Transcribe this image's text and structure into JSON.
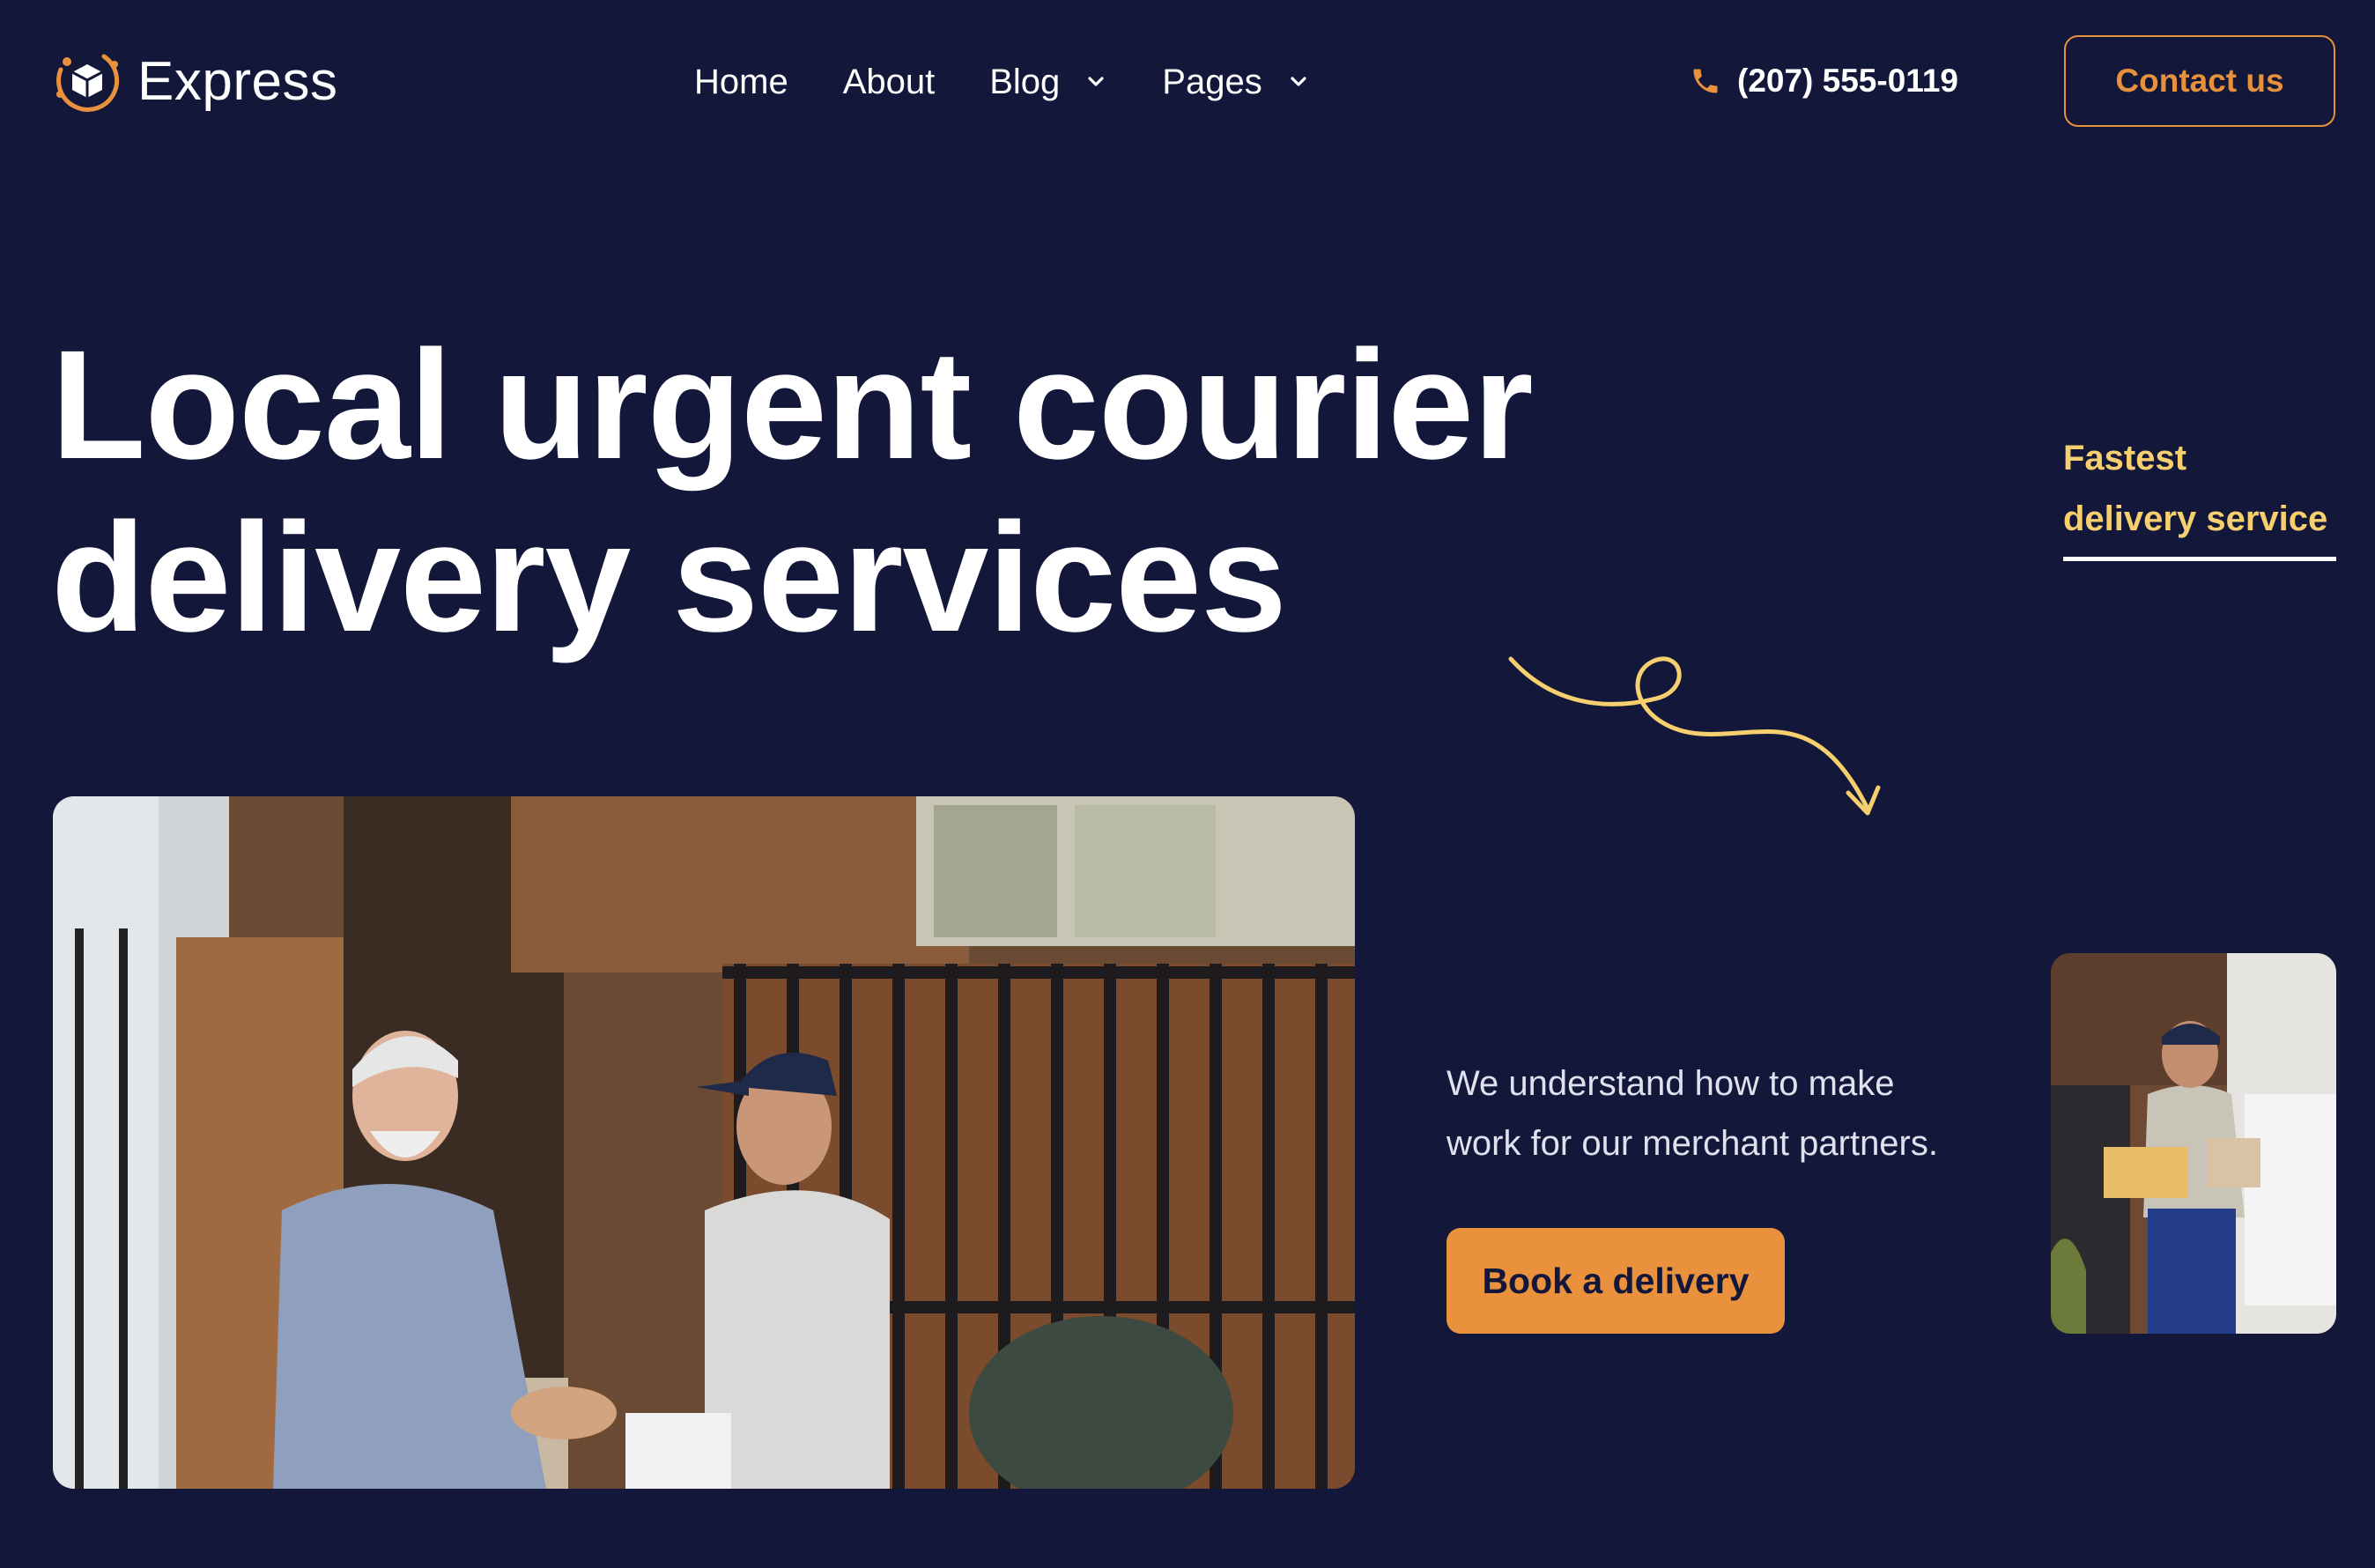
{
  "brand": {
    "name": "Express",
    "icon": "box-logo-icon",
    "accent_color": "#ea913d",
    "background_color": "#13173a",
    "highlight_color": "#f6cf6f"
  },
  "nav": {
    "items": [
      {
        "label": "Home",
        "has_dropdown": false
      },
      {
        "label": "About",
        "has_dropdown": false
      },
      {
        "label": "Blog",
        "has_dropdown": true
      },
      {
        "label": "Pages",
        "has_dropdown": true
      }
    ]
  },
  "header": {
    "phone": "(207) 555-0119",
    "phone_icon": "phone-icon",
    "contact_label": "Contact us"
  },
  "hero": {
    "title_line1": "Local urgent courier",
    "title_line2": "delivery services",
    "side_note_line1": "Fastest",
    "side_note_line2": "delivery service",
    "tagline_line1": "We understand how to make",
    "tagline_line2": "work for our merchant partners.",
    "cta_label": "Book a delivery"
  }
}
